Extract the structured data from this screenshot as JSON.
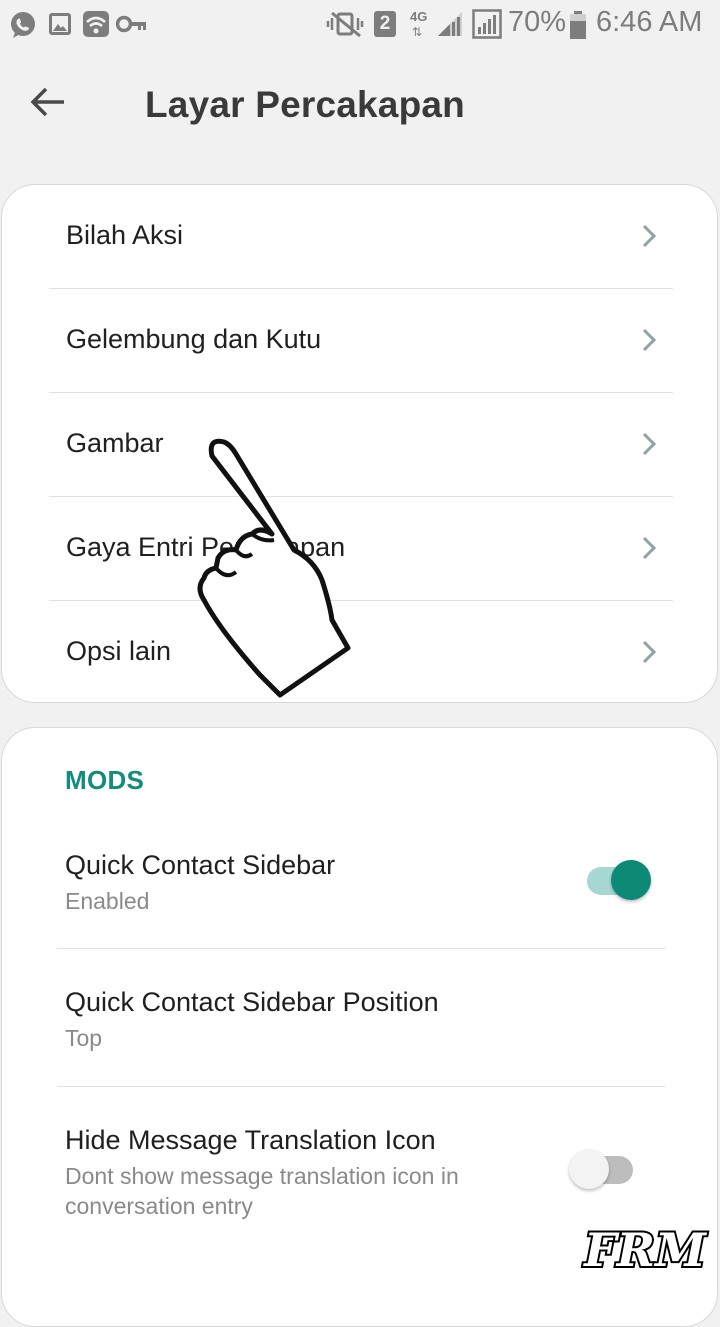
{
  "status_bar": {
    "sim_slot": "2",
    "network": "4G",
    "battery": "70%",
    "time": "6:46 AM",
    "icons": [
      "whatsapp-icon",
      "gallery-icon",
      "wifi-icon",
      "key-icon",
      "mute-icon",
      "sim-icon",
      "network-4g-icon",
      "signal-icon",
      "signal-icon",
      "battery-icon"
    ]
  },
  "app_bar": {
    "back_icon": "back-arrow-icon",
    "title": "Layar Percakapan"
  },
  "menu": {
    "items": [
      {
        "label": "Bilah Aksi"
      },
      {
        "label": "Gelembung dan Kutu"
      },
      {
        "label": "Gambar"
      },
      {
        "label": "Gaya Entri Percakapan"
      },
      {
        "label": "Opsi lain"
      }
    ],
    "chevron_icon": "chevron-right-icon"
  },
  "mods": {
    "title": "MODS",
    "accent_color": "#128c7e",
    "settings": [
      {
        "title": "Quick Contact Sidebar",
        "subtitle": "Enabled",
        "toggle": true
      },
      {
        "title": "Quick Contact Sidebar Position",
        "subtitle": "Top"
      },
      {
        "title": "Hide Message Translation Icon",
        "subtitle": "Dont show message translation icon in conversation entry",
        "toggle": false
      }
    ]
  },
  "overlay": {
    "hand_icon": "pointing-hand-icon",
    "watermark": "FRM"
  }
}
